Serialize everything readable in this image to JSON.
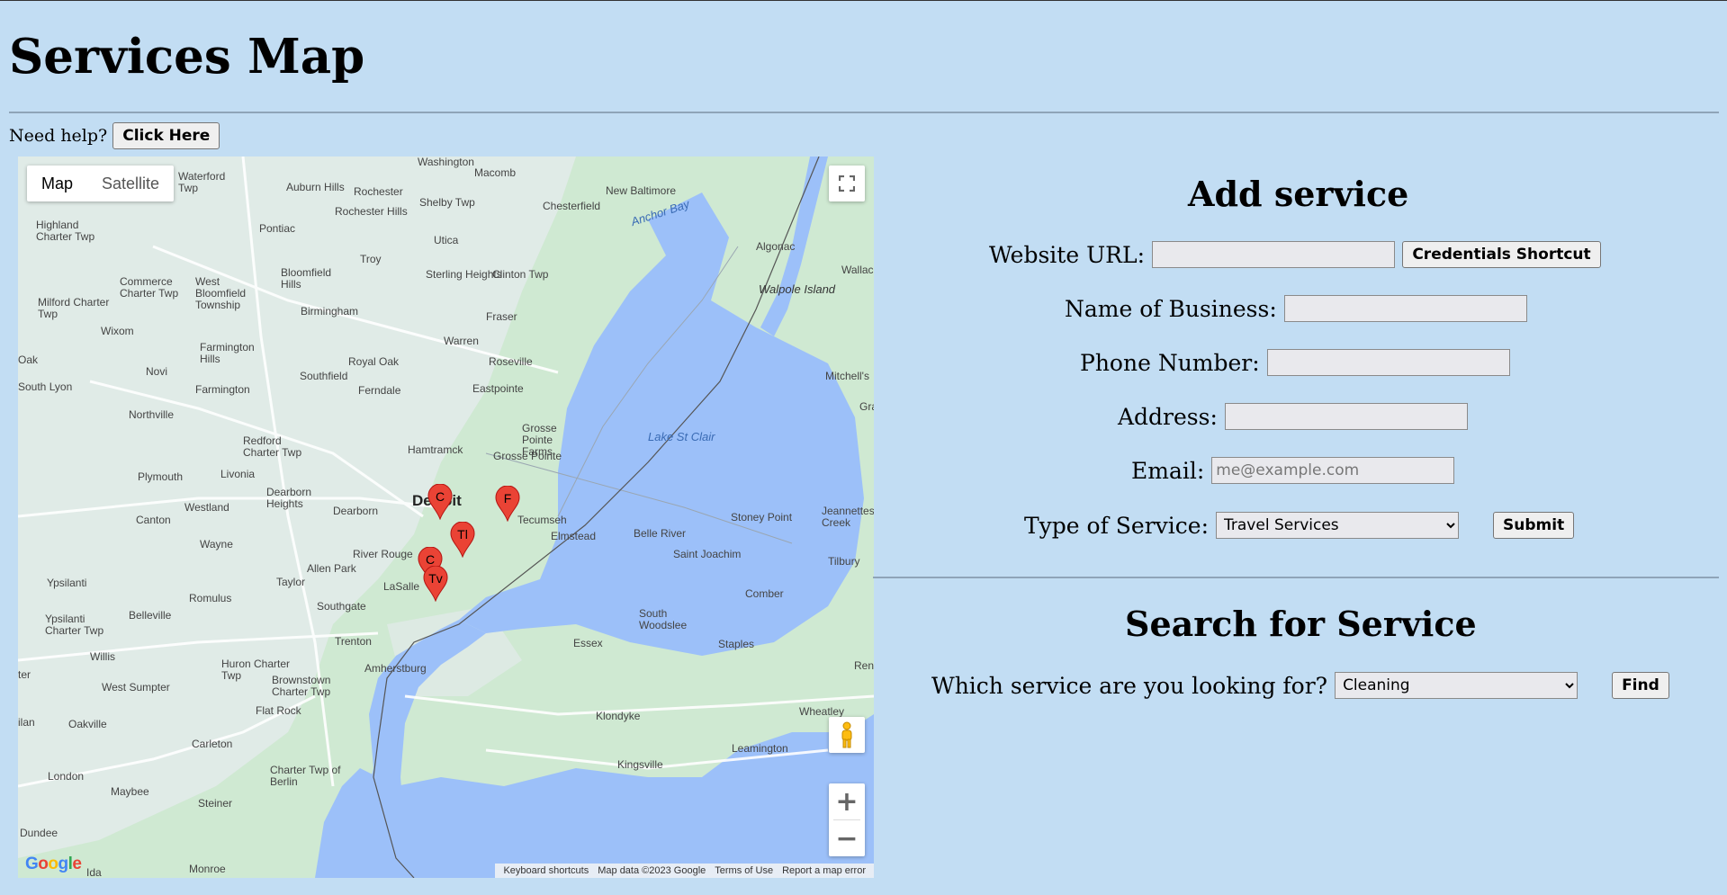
{
  "page": {
    "title": "Services Map"
  },
  "help": {
    "label": "Need help?",
    "button": "Click Here"
  },
  "map": {
    "type_control": {
      "map": "Map",
      "satellite": "Satellite"
    },
    "attribution": [
      "Keyboard shortcuts",
      "Map data ©2023 Google",
      "Terms of Use",
      "Report a map error"
    ],
    "logo": "Google",
    "markers": [
      "C",
      "F",
      "Tl",
      "C",
      "Tv"
    ],
    "places": {
      "detroit": "Detroit",
      "lake": "Lake St Clair",
      "anchor_bay": "Anchor Bay",
      "warren": "Warren",
      "troy": "Troy",
      "livonia": "Livonia",
      "dearborn": "Dearborn",
      "southfield": "Southfield",
      "windsor_tecumseh": "Tecumseh",
      "taylor": "Taylor",
      "pontiac": "Pontiac",
      "rochester_hills": "Rochester Hills",
      "sterling": "Sterling Heights",
      "roseville": "Roseville",
      "eastpointe": "Eastpointe",
      "hamtramck": "Hamtramck",
      "westland": "Westland",
      "canton": "Canton",
      "wayne": "Wayne",
      "romulus": "Romulus",
      "southgate": "Southgate",
      "trenton": "Trenton",
      "amherstburg": "Amherstburg",
      "lasalle": "LaSalle",
      "essex": "Essex",
      "belle_river": "Belle River",
      "kingsville": "Kingsville",
      "leamington": "Leamington",
      "comber": "Comber",
      "monroe": "Monroe",
      "ypsilanti": "Ypsilanti",
      "novi": "Novi",
      "algonac": "Algonac",
      "new_baltimore": "New Baltimore",
      "chesterfield": "Chesterfield",
      "macomb": "Macomb",
      "utica": "Utica",
      "fraser": "Fraser",
      "royal_oak": "Royal Oak",
      "ferndale": "Ferndale",
      "birmingham": "Birmingham",
      "plymouth": "Plymouth",
      "northville": "Northville",
      "farmington": "Farmington",
      "belleville": "Belleville",
      "flat_rock": "Flat Rock",
      "carleton": "Carleton",
      "maybee": "Maybee",
      "dundee": "Dundee",
      "stoney_point": "Stoney Point",
      "saint_joachim": "Saint Joachim",
      "elmstead": "Elmstead",
      "staples": "Staples",
      "wheatley": "Wheatley",
      "klondyke": "Klondyke",
      "walpole": "Walpole Island",
      "mitchells": "Mitchell's",
      "tilbury": "Tilbury",
      "river_rouge": "River Rouge",
      "allen_park": "Allen Park",
      "wixom": "Wixom",
      "milford": "Milford Charter Twp",
      "waterford": "Waterford Twp",
      "shelby": "Shelby Twp",
      "clinton": "Clinton Twp",
      "auburn_hills": "Auburn Hills",
      "rochester": "Rochester",
      "washington": "Washington",
      "highland": "Highland Charter Twp",
      "commerce": "Commerce Charter Twp",
      "west_bloomfield": "West Bloomfield Township",
      "bloomfield_hills": "Bloomfield Hills",
      "farmington_hills": "Farmington Hills",
      "redford": "Redford Charter Twp",
      "dearborn_heights": "Dearborn Heights",
      "grosse_pointe": "Grosse Pointe",
      "grosse_pointe_farms": "Grosse Pointe Farms",
      "huron": "Huron Charter Twp",
      "brownstown": "Brownstown Charter Twp",
      "west_sumpter": "West Sumpter",
      "willis": "Willis",
      "oakville": "Oakville",
      "london": "London",
      "steiner": "Steiner",
      "ida": "Ida",
      "south_woodslee": "South Woodslee",
      "jeannettes": "Jeannettes Creek",
      "wallac": "Wallac",
      "gra": "Gra",
      "ren": "Ren",
      "ypsilanti_twp": "Ypsilanti Charter Twp",
      "south_lyon": "South Lyon",
      "oak": "Oak",
      "ter": "ter",
      "ilan": "ilan",
      "charter_berlin": "Charter Twp of Berlin"
    }
  },
  "add_service": {
    "title": "Add service",
    "website_label": "Website URL:",
    "website_value": "",
    "credentials_button": "Credentials Shortcut",
    "business_label": "Name of Business:",
    "phone_label": "Phone Number:",
    "address_label": "Address:",
    "email_label": "Email:",
    "email_placeholder": "me@example.com",
    "type_label": "Type of Service:",
    "type_selected": "Travel Services",
    "submit": "Submit"
  },
  "search_service": {
    "title": "Search for Service",
    "label": "Which service are you looking for?",
    "selected": "Cleaning",
    "find": "Find"
  },
  "colors": {
    "background": "#c2ddf3",
    "water": "#9cc0f9",
    "land": "#cfe9d2",
    "urban": "#e8ecef",
    "marker": "#ea4335"
  }
}
